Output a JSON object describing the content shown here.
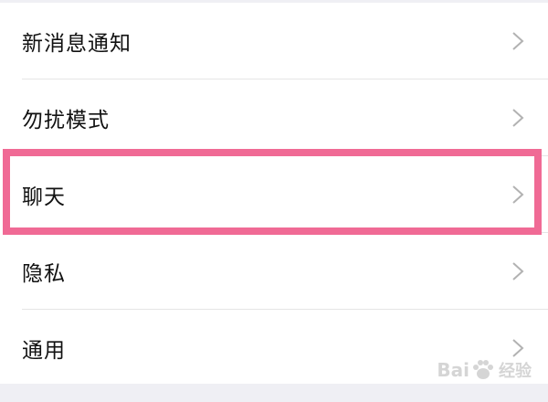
{
  "settings": {
    "items": [
      {
        "label": "新消息通知"
      },
      {
        "label": "勿扰模式"
      },
      {
        "label": "聊天"
      },
      {
        "label": "隐私"
      },
      {
        "label": "通用"
      }
    ],
    "highlighted_index": 2
  },
  "watermark": {
    "text_left": "Bai",
    "text_right": "经验",
    "icon": "baidu-paw-icon"
  },
  "colors": {
    "highlight": "#f06a95",
    "background": "#efeff4",
    "row_bg": "#ffffff",
    "chevron": "#b2b2b2"
  }
}
